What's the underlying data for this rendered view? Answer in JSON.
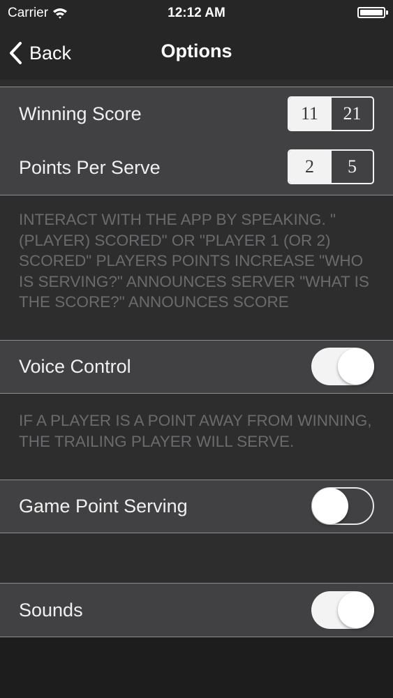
{
  "status_bar": {
    "carrier": "Carrier",
    "time": "12:12 AM",
    "wifi_icon": "wifi-icon",
    "battery_icon": "battery-icon"
  },
  "nav": {
    "back_label": "Back",
    "back_icon": "chevron-left-icon",
    "title": "Options"
  },
  "settings": {
    "winning_score": {
      "label": "Winning Score",
      "options": [
        "11",
        "21"
      ],
      "selected": "11"
    },
    "points_per_serve": {
      "label": "Points Per Serve",
      "options": [
        "2",
        "5"
      ],
      "selected": "2"
    },
    "voice_note": "Interact with the app by speaking. \"(Player) scored\" or \"Player 1 (or 2) scored\" players points increase \"Who is serving?\" announces server \"What is the score?\" announces score",
    "voice_control": {
      "label": "Voice Control",
      "on": true
    },
    "game_point_note": "If a player is a point away from winning, the trailing player will serve.",
    "game_point_serving": {
      "label": "Game Point Serving",
      "on": false
    },
    "sounds": {
      "label": "Sounds",
      "on": true
    }
  },
  "colors": {
    "background": "#2e2d2e",
    "cell": "#414042",
    "bar": "#262626",
    "note_text": "#6b6a6d",
    "toggle_on": "#f3f3f3"
  }
}
